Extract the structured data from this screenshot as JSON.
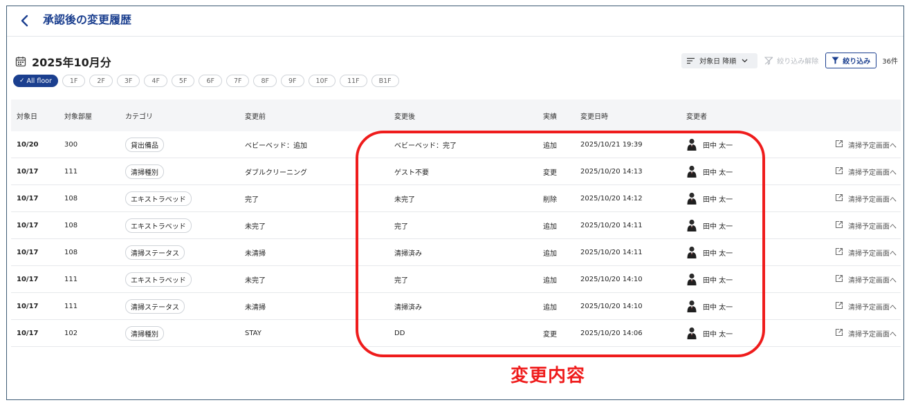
{
  "header": {
    "title": "承認後の変更履歴"
  },
  "period": {
    "label": "2025年10月分"
  },
  "floors": [
    {
      "label": "All floor",
      "active": true
    },
    {
      "label": "1F"
    },
    {
      "label": "2F"
    },
    {
      "label": "3F"
    },
    {
      "label": "4F"
    },
    {
      "label": "5F"
    },
    {
      "label": "6F"
    },
    {
      "label": "7F"
    },
    {
      "label": "8F"
    },
    {
      "label": "9F"
    },
    {
      "label": "10F"
    },
    {
      "label": "11F"
    },
    {
      "label": "B1F"
    }
  ],
  "toolbar": {
    "sort_label": "対象日 降順",
    "clear_label": "絞り込み解除",
    "filter_label": "絞り込み",
    "count": "36件"
  },
  "table": {
    "headers": {
      "date": "対象日",
      "room": "対象部屋",
      "category": "カテゴリ",
      "before": "変更前",
      "after": "変更後",
      "result": "実績",
      "changed_at": "変更日時",
      "changed_by": "変更者"
    },
    "link_label": "清掃予定画面へ",
    "rows": [
      {
        "date": "10/20",
        "room": "300",
        "category": "貸出備品",
        "before": "ベビーベッド：追加",
        "after": "ベビーベッド：完了",
        "result": "追加",
        "changed_at": "2025/10/21 19:39",
        "changed_by": "田中 太一"
      },
      {
        "date": "10/17",
        "room": "111",
        "category": "清掃種別",
        "before": "ダブルクリーニング",
        "after": "ゲスト不要",
        "result": "変更",
        "changed_at": "2025/10/20 14:13",
        "changed_by": "田中 太一"
      },
      {
        "date": "10/17",
        "room": "108",
        "category": "エキストラベッド",
        "before": "完了",
        "after": "未完了",
        "result": "削除",
        "changed_at": "2025/10/20 14:12",
        "changed_by": "田中 太一"
      },
      {
        "date": "10/17",
        "room": "108",
        "category": "エキストラベッド",
        "before": "未完了",
        "after": "完了",
        "result": "追加",
        "changed_at": "2025/10/20 14:11",
        "changed_by": "田中 太一"
      },
      {
        "date": "10/17",
        "room": "108",
        "category": "清掃ステータス",
        "before": "未清掃",
        "after": "清掃済み",
        "result": "追加",
        "changed_at": "2025/10/20 14:11",
        "changed_by": "田中 太一"
      },
      {
        "date": "10/17",
        "room": "111",
        "category": "エキストラベッド",
        "before": "未完了",
        "after": "完了",
        "result": "追加",
        "changed_at": "2025/10/20 14:10",
        "changed_by": "田中 太一"
      },
      {
        "date": "10/17",
        "room": "111",
        "category": "清掃ステータス",
        "before": "未清掃",
        "after": "清掃済み",
        "result": "追加",
        "changed_at": "2025/10/20 14:10",
        "changed_by": "田中 太一"
      },
      {
        "date": "10/17",
        "room": "102",
        "category": "清掃種別",
        "before": "STAY",
        "after": "DD",
        "result": "変更",
        "changed_at": "2025/10/20 14:06",
        "changed_by": "田中 太一"
      }
    ]
  },
  "annotation": {
    "label": "変更内容",
    "color": "#ef1c1c"
  },
  "colors": {
    "primary": "#1b3f8f",
    "border": "#3c5a74"
  }
}
